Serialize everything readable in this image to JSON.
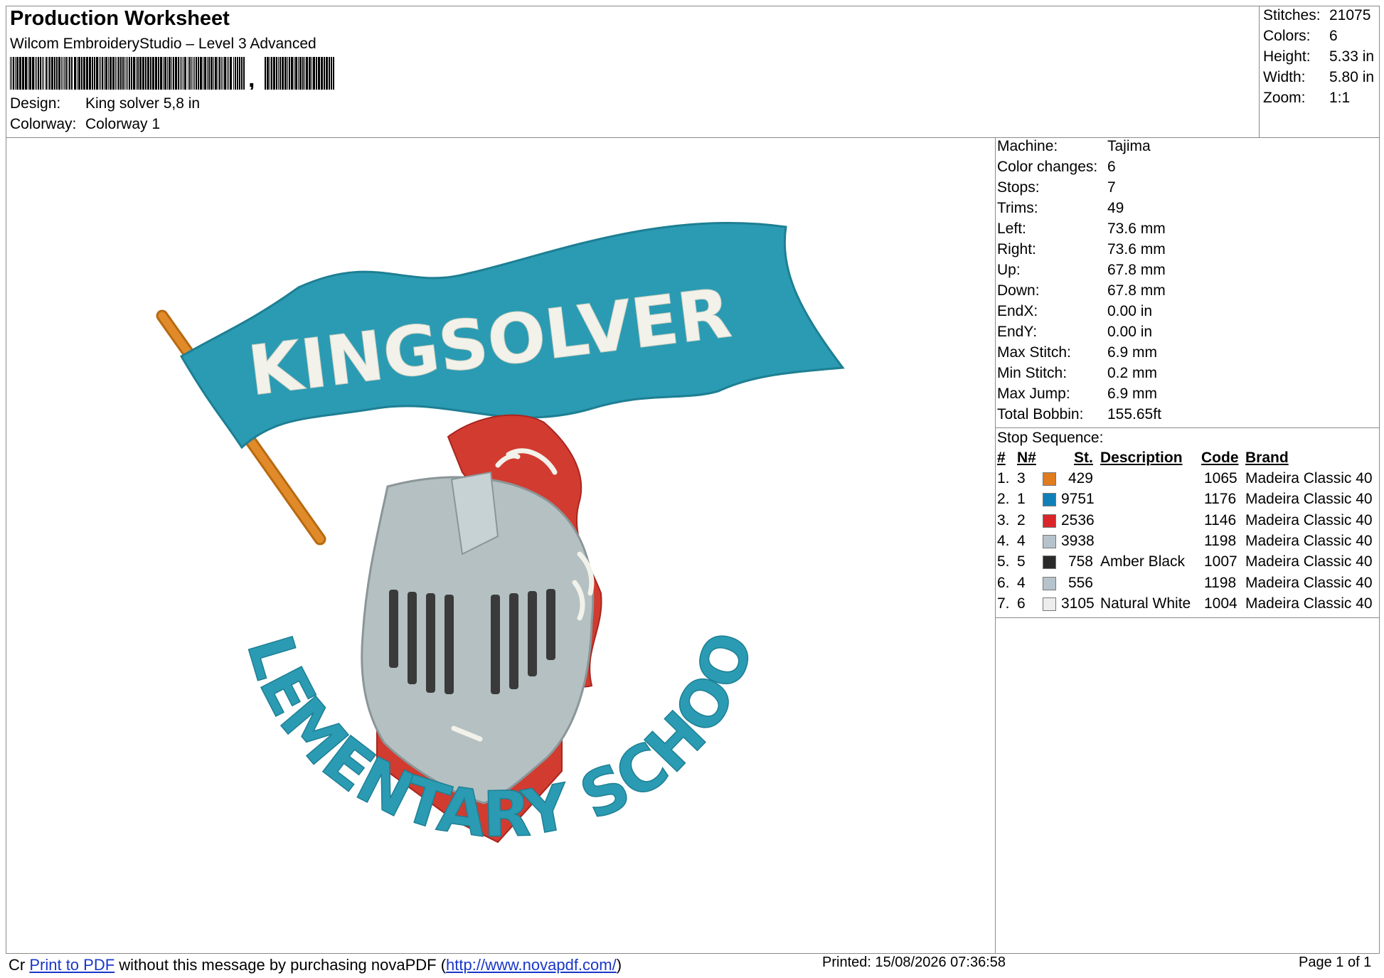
{
  "header": {
    "title": "Production Worksheet",
    "software": "Wilcom EmbroideryStudio – Level 3 Advanced",
    "design_label": "Design:",
    "design_value": "King solver 5,8 in",
    "colorway_label": "Colorway:",
    "colorway_value": "Colorway 1"
  },
  "summary": [
    {
      "label": "Stitches:",
      "value": "21075"
    },
    {
      "label": "Colors:",
      "value": "6"
    },
    {
      "label": "Height:",
      "value": "5.33 in"
    },
    {
      "label": "Width:",
      "value": "5.80 in"
    },
    {
      "label": "Zoom:",
      "value": "1:1"
    }
  ],
  "machine_info": [
    {
      "label": "Machine:",
      "value": "Tajima"
    },
    {
      "label": "Color changes:",
      "value": "6"
    },
    {
      "label": "Stops:",
      "value": "7"
    },
    {
      "label": "Trims:",
      "value": "49"
    },
    {
      "label": "Left:",
      "value": "73.6 mm"
    },
    {
      "label": "Right:",
      "value": "73.6 mm"
    },
    {
      "label": "Up:",
      "value": "67.8 mm"
    },
    {
      "label": "Down:",
      "value": "67.8 mm"
    },
    {
      "label": "EndX:",
      "value": "0.00 in"
    },
    {
      "label": "EndY:",
      "value": "0.00 in"
    },
    {
      "label": "Max Stitch:",
      "value": "6.9 mm"
    },
    {
      "label": "Min Stitch:",
      "value": "0.2 mm"
    },
    {
      "label": "Max Jump:",
      "value": "6.9 mm"
    },
    {
      "label": "Total Bobbin:",
      "value": "155.65ft"
    }
  ],
  "stop_sequence": {
    "title": "Stop Sequence:",
    "headers": {
      "num": "#",
      "n": "N#",
      "st": "St.",
      "description": "Description",
      "code": "Code",
      "brand": "Brand"
    },
    "rows": [
      {
        "num": "1.",
        "n": "3",
        "color": "#e07b1e",
        "st": "429",
        "description": "",
        "code": "1065",
        "brand": "Madeira Classic 40"
      },
      {
        "num": "2.",
        "n": "1",
        "color": "#1180b8",
        "st": "9751",
        "description": "",
        "code": "1176",
        "brand": "Madeira Classic 40"
      },
      {
        "num": "3.",
        "n": "2",
        "color": "#d8262b",
        "st": "2536",
        "description": "",
        "code": "1146",
        "brand": "Madeira Classic 40"
      },
      {
        "num": "4.",
        "n": "4",
        "color": "#b6c3cc",
        "st": "3938",
        "description": "",
        "code": "1198",
        "brand": "Madeira Classic 40"
      },
      {
        "num": "5.",
        "n": "5",
        "color": "#2a2a2a",
        "st": "758",
        "description": "Amber Black",
        "code": "1007",
        "brand": "Madeira Classic 40"
      },
      {
        "num": "6.",
        "n": "4",
        "color": "#b6c3cc",
        "st": "556",
        "description": "",
        "code": "1198",
        "brand": "Madeira Classic 40"
      },
      {
        "num": "7.",
        "n": "6",
        "color": "#ededed",
        "st": "3105",
        "description": "Natural White",
        "code": "1004",
        "brand": "Madeira Classic 40"
      }
    ]
  },
  "design": {
    "banner_text": "KINGSOLVER",
    "arc_text": "ELEMENTARY SCHOOL",
    "colors": {
      "teal": "#2a9bb3",
      "pole": "#e08a2a",
      "plume": "#d23b30",
      "helmet": "#b4c0c2",
      "slots": "#3a3a3a",
      "white": "#f2f2ea"
    }
  },
  "footer": {
    "prefix": "Cr",
    "link1": "Print to PDF",
    "middle": " without this message by purchasing novaPDF (",
    "link2": "http://www.novapdf.com/",
    "close": ")",
    "printed": "Printed: 15/08/2026 07:36:58",
    "page": "Page 1 of 1"
  }
}
